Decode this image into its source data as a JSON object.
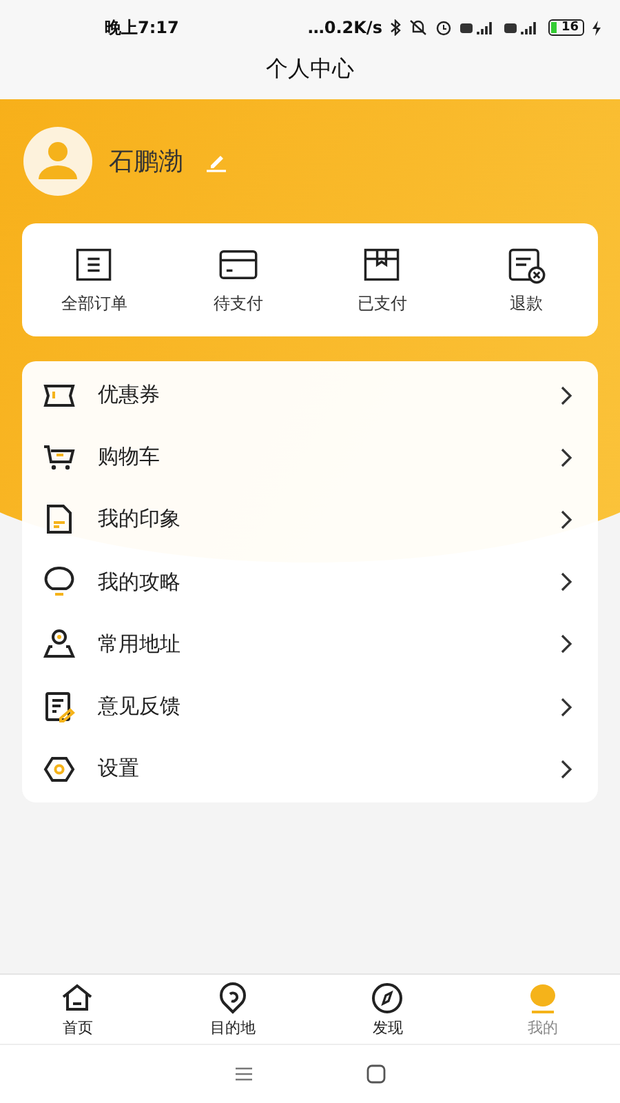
{
  "status_bar": {
    "time": "晚上7:17",
    "speed": "…0.2K/s",
    "battery": "16"
  },
  "title": "个人中心",
  "profile": {
    "name": "石鹏渤"
  },
  "orders": [
    {
      "label": "全部订单",
      "kind": "list"
    },
    {
      "label": "待支付",
      "kind": "card"
    },
    {
      "label": "已支付",
      "kind": "box"
    },
    {
      "label": "退款",
      "kind": "refund"
    }
  ],
  "menu": [
    {
      "label": "优惠券",
      "kind": "ticket"
    },
    {
      "label": "购物车",
      "kind": "cart"
    },
    {
      "label": "我的印象",
      "kind": "doc"
    },
    {
      "label": "我的攻略",
      "kind": "bulb"
    },
    {
      "label": "常用地址",
      "kind": "pin"
    },
    {
      "label": "意见反馈",
      "kind": "note"
    },
    {
      "label": "设置",
      "kind": "hex"
    }
  ],
  "tabs": [
    {
      "label": "首页",
      "kind": "home",
      "selected": false
    },
    {
      "label": "目的地",
      "kind": "place",
      "selected": false
    },
    {
      "label": "发现",
      "kind": "compass",
      "selected": false
    },
    {
      "label": "我的",
      "kind": "person",
      "selected": true
    }
  ]
}
